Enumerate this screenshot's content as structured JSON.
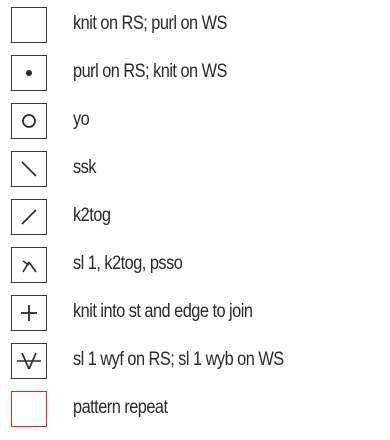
{
  "legend": {
    "items": [
      {
        "icon": "blank-square-icon",
        "label": "knit on RS; purl on WS"
      },
      {
        "icon": "dot-icon",
        "label": "purl on RS; knit on WS"
      },
      {
        "icon": "circle-icon",
        "label": "yo"
      },
      {
        "icon": "backslash-icon",
        "label": "ssk"
      },
      {
        "icon": "slash-icon",
        "label": "k2tog"
      },
      {
        "icon": "lambda-icon",
        "label": "sl 1, k2tog, psso"
      },
      {
        "icon": "plus-icon",
        "label": "knit into st and edge to join"
      },
      {
        "icon": "slip-wyf-icon",
        "label": "sl 1 wyf on RS; sl 1 wyb on WS"
      },
      {
        "icon": "red-square-icon",
        "label": "pattern repeat"
      }
    ],
    "colors": {
      "symbol_border": "#3a3a3a",
      "repeat_border": "#d7282f",
      "text": "#2a2a2a"
    }
  }
}
